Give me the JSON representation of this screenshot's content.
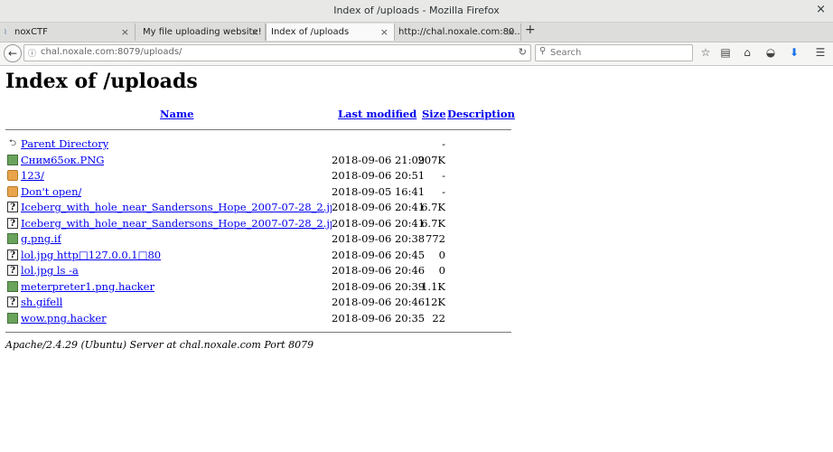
{
  "window": {
    "title": "Index of /uploads - Mozilla Firefox",
    "close": "×"
  },
  "tabs": [
    {
      "label": "noxCTF",
      "close": "×"
    },
    {
      "label": "My file uploading website!",
      "close": "×"
    },
    {
      "label": "Index of /uploads",
      "close": "×"
    },
    {
      "label": "http://chal.noxale.com:80...",
      "close": "×"
    }
  ],
  "newtab": "+",
  "nav": {
    "back": "←",
    "info": "ⓘ",
    "url": "chal.noxale.com:8079/uploads/",
    "reload": "↻",
    "search_placeholder": "Search"
  },
  "page": {
    "heading": "Index of /uploads",
    "columns": {
      "name": "Name",
      "modified": "Last modified",
      "size": "Size",
      "description": "Description"
    },
    "entries": [
      {
        "icon": "back-icon",
        "name": "Parent Directory",
        "modified": "",
        "size": "-"
      },
      {
        "icon": "image-icon",
        "name": "Сним65ок.PNG",
        "modified": "2018-09-06 21:09",
        "size": "207K"
      },
      {
        "icon": "folder-icon",
        "name": "123/",
        "modified": "2018-09-06 20:51",
        "size": "-"
      },
      {
        "icon": "folder-icon",
        "name": "Don't open/",
        "modified": "2018-09-05 16:41",
        "size": "-"
      },
      {
        "icon": "unknown-file-icon",
        "name": "Iceberg_with_hole_near_Sandersons_Hope_2007-07-28_2.jpg1",
        "modified": "2018-09-06 20:41",
        "size": "6.7K"
      },
      {
        "icon": "unknown-file-icon",
        "name": "Iceberg_with_hole_near_Sandersons_Hope_2007-07-28_2.jpg1.",
        "modified": "2018-09-06 20:41",
        "size": "6.7K"
      },
      {
        "icon": "image-icon",
        "name": "g.png.if",
        "modified": "2018-09-06 20:38",
        "size": "772"
      },
      {
        "icon": "unknown-file-icon",
        "name": "lol.jpg http□127.0.0.1□80",
        "modified": "2018-09-06 20:45",
        "size": "0"
      },
      {
        "icon": "unknown-file-icon",
        "name": "lol.jpg ls -a",
        "modified": "2018-09-06 20:46",
        "size": "0"
      },
      {
        "icon": "image-icon",
        "name": "meterpreter1.png.hacker",
        "modified": "2018-09-06 20:39",
        "size": "1.1K"
      },
      {
        "icon": "unknown-file-icon",
        "name": "sh.gifell",
        "modified": "2018-09-06 20:46",
        "size": "12K"
      },
      {
        "icon": "image-icon",
        "name": "wow.png.hacker",
        "modified": "2018-09-06 20:35",
        "size": "22"
      }
    ],
    "address": "Apache/2.4.29 (Ubuntu) Server at chal.noxale.com Port 8079"
  }
}
